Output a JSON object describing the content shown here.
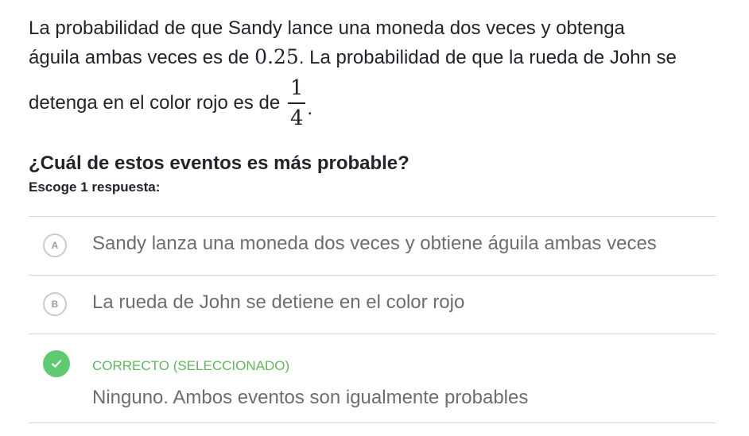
{
  "question": {
    "line1": "La probabilidad de que Sandy lance una moneda dos veces y obtenga",
    "line2_before": "águila ambas veces es de ",
    "line2_value": "0.25",
    "line2_after": ". La probabilidad de que la rueda de John se",
    "line3_before": "detenga en el color rojo es de",
    "fraction_numerator": "1",
    "fraction_denominator": "4",
    "line3_after": "."
  },
  "prompt": "¿Cuál de estos eventos es más probable?",
  "instructions": "Escoge 1 respuesta:",
  "choices": [
    {
      "letter": "A",
      "label": "Sandy lanza una moneda dos veces y obtiene águila ambas veces"
    },
    {
      "letter": "B",
      "label": "La rueda de John se detiene en el color rojo"
    },
    {
      "status": "CORRECTO (SELECCIONADO)",
      "label": "Ninguno. Ambos eventos son igualmente probables",
      "selected": true,
      "correct": true
    }
  ],
  "colors": {
    "text": "#21242c",
    "choice_text": "#6b6d72",
    "correct_green": "#5fca6f",
    "divider": "#d6d8da"
  }
}
